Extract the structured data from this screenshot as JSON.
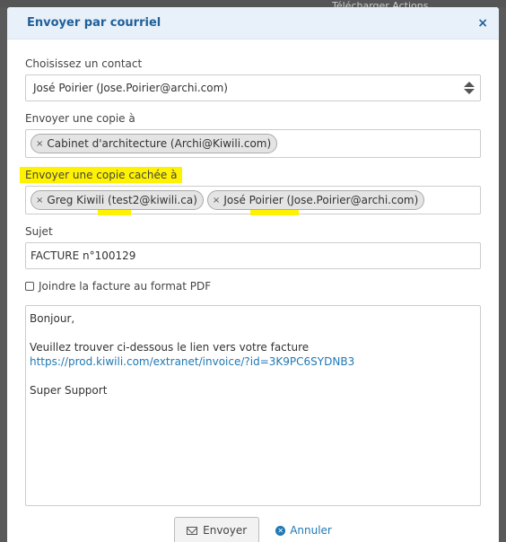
{
  "background": {
    "top_right_text": "Télécharger   Actions"
  },
  "modal": {
    "title": "Envoyer par courriel",
    "close_symbol": "×"
  },
  "contact": {
    "label": "Choisissez un contact",
    "value": "José Poirier (Jose.Poirier@archi.com)"
  },
  "cc": {
    "label": "Envoyer une copie à",
    "tags": [
      "Cabinet d'architecture (Archi@Kiwili.com)"
    ]
  },
  "bcc": {
    "label": "Envoyer une copie cachée à",
    "tags": [
      "Greg Kiwili (test2@kiwili.ca)",
      "José Poirier (Jose.Poirier@archi.com)"
    ]
  },
  "subject": {
    "label": "Sujet",
    "value": "FACTURE n°100129"
  },
  "attach_pdf": {
    "label": "Joindre la facture au format PDF",
    "checked": false
  },
  "message": {
    "greeting": "Bonjour,",
    "line1": "Veuillez trouver ci-dessous le lien vers votre facture",
    "link": "https://prod.kiwili.com/extranet/invoice/?id=3K9PC6SYDNB3",
    "signature": "Super Support"
  },
  "footer": {
    "send_label": "Envoyer",
    "cancel_label": "Annuler"
  },
  "colors": {
    "accent": "#1f5f99",
    "link": "#1f78b4",
    "highlight": "#fff200"
  }
}
